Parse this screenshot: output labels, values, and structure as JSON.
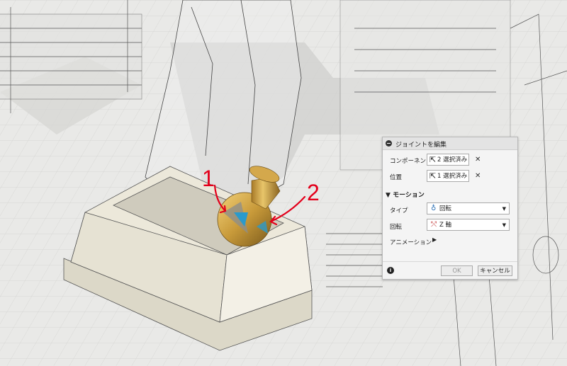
{
  "annotations": {
    "label_1": "1",
    "label_2": "2"
  },
  "dialog": {
    "title": "ジョイントを編集",
    "component": {
      "label": "コンポーネント",
      "selection": "2 選択済み"
    },
    "position": {
      "label": "位置",
      "selection": "1 選択済み"
    },
    "motion": {
      "section_title": "モーション",
      "type": {
        "label": "タイプ",
        "value": "回転"
      },
      "rotation": {
        "label": "回転",
        "value": "Z 軸"
      },
      "animation": {
        "label": "アニメーション"
      }
    },
    "footer": {
      "ok": "OK",
      "cancel": "キャンセル"
    }
  },
  "colors": {
    "annotation_red": "#e3001b",
    "gold": "#c89a3a",
    "background": "#e9e9e7"
  }
}
